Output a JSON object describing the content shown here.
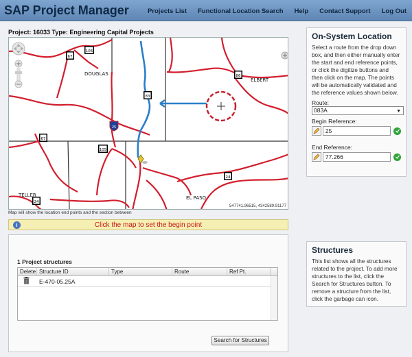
{
  "header": {
    "app_title": "SAP Project Manager",
    "nav": [
      "Projects List",
      "Functional Location Search",
      "Help",
      "Contact Support",
      "Log Out"
    ]
  },
  "project": {
    "heading": "Project: 16033 Type: Engineering Capital Projects"
  },
  "map": {
    "labels": {
      "douglas": "DOUGLAS",
      "elbert": "ELBERT",
      "teller": "TELLER",
      "elpaso": "EL PASO"
    },
    "shields": [
      "105",
      "67",
      "86",
      "83",
      "25",
      "105",
      "67",
      "24",
      "24"
    ],
    "coords": "547741.96515, 4342589.91177",
    "note": "Map will show the location end points and the section between"
  },
  "info_bar": {
    "icon": "info-icon",
    "message": "Click the map to set the begin point"
  },
  "on_system": {
    "title": "On-System Location",
    "description": "Select a route from the drop down box, and then either manually enter the start and end reference points, or click the digitize buttons and then click on the map. The points will be automatically validated and the reference values shown below.",
    "route_label": "Route:",
    "route_value": "083A",
    "begin_label": "Begin Reference:",
    "begin_value": "25",
    "end_label": "End Reference:",
    "end_value": "77.266"
  },
  "project_structures": {
    "heading": "1 Project structures",
    "columns": [
      "Delete",
      "Structure ID",
      "Type",
      "Route",
      "Ref Pt."
    ],
    "rows": [
      {
        "structure_id": "E-470-05.25A",
        "type": "",
        "route": "",
        "ref_pt": ""
      }
    ],
    "search_button": "Search for Structures"
  },
  "structures_panel": {
    "title": "Structures",
    "description": "This list shows all the structures related to the project. To add more structures to the list, click the Search for Structures button. To remove a structure from the list, click the garbage can icon."
  },
  "colors": {
    "header_bg": "#6f96c2",
    "roads": "#d21e2d",
    "route_line": "#2a7fc9",
    "info_text": "#c81414",
    "ok": "#2fa43a"
  }
}
